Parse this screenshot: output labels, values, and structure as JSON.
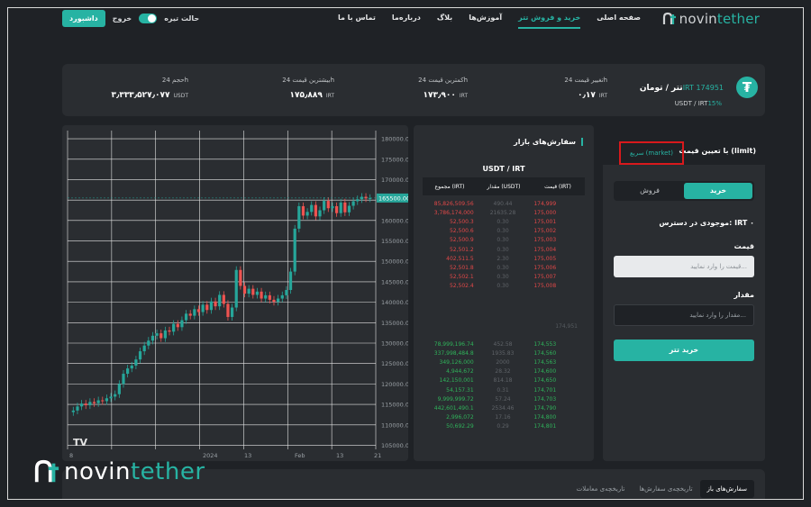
{
  "nav": {
    "logo_left": "novin",
    "logo_right": "tether",
    "menu": [
      "صفحه اصلی",
      "خرید و فروش تتر",
      "آموزش‌ها",
      "بلاگ",
      "درباره‌ما",
      "تماس با ما"
    ],
    "dashboard": "داشبورد",
    "logout": "خروج",
    "dark_mode": "حالت تیره"
  },
  "stats": {
    "coin_symbol": "₮",
    "pair_title": "تتر / تومان",
    "pair_price": "IRT 174951",
    "pair_sub": "USDT / IRT",
    "pair_change": "15%",
    "change_label": "تغییر قیمت 24h",
    "change_value": "۰٫۱۷",
    "low_label": "کمترین قیمت 24h",
    "low_value": "۱۷۳٫۹۰۰",
    "high_label": "بیشترین قیمت 24h",
    "high_value": "۱۷۵٫۸۸۹",
    "vol_label": "حجم 24h",
    "vol_value": "۳٫۳۳۳٫۵۲۷٫۰۷۷",
    "unit_irt": "IRT",
    "unit_usdt": "USDT"
  },
  "chart_data": {
    "type": "candlestick",
    "x_tick_labels": [
      "8",
      "2024",
      "13",
      "Feb",
      "13",
      "21"
    ],
    "y_ticks": [
      180000,
      175000,
      170000,
      165000,
      160000,
      155000,
      150000,
      145000,
      140000,
      135000,
      130000,
      125000,
      120000,
      115000,
      110000,
      105000
    ],
    "y_tick_labels": [
      "180000.00",
      "175000.00",
      "170000.00",
      "165000.00",
      "160000.00",
      "155000.00",
      "150000.00",
      "145000.00",
      "140000.00",
      "135000.00",
      "130000.00",
      "125000.00",
      "120000.00",
      "115000.00",
      "110000.00",
      "105000.00"
    ],
    "ylim": [
      104000,
      182000
    ],
    "last_price": 165500,
    "last_price_label": "165500.00",
    "closes": [
      113500,
      114500,
      115200,
      114800,
      115600,
      115300,
      116000,
      115800,
      116500,
      116900,
      117500,
      120000,
      122500,
      123800,
      124500,
      126000,
      128000,
      129400,
      130600,
      131800,
      132400,
      131200,
      133100,
      132800,
      134700,
      133900,
      135600,
      137200,
      136700,
      138300,
      137600,
      139400,
      138100,
      140200,
      139000,
      141800,
      139600,
      136400,
      138700,
      147900,
      144000,
      142100,
      143300,
      141800,
      142600,
      140900,
      141700,
      140600,
      140100,
      140900,
      141700,
      143000,
      147500,
      158000,
      163500,
      161200,
      162100,
      163800,
      161000,
      162500,
      164800,
      163000,
      163500,
      161800,
      164400,
      162000,
      163600,
      164700,
      165200,
      165800,
      165400,
      165500
    ]
  },
  "book": {
    "title": "سفارش‌های بازار",
    "pair": "USDT / IRT",
    "h_price": "قیمت (IRT)",
    "h_amount": "مقدار (USDT)",
    "h_total": "مجموع (IRT)",
    "sell_rows": [
      {
        "total": "85,826,509.56",
        "amount": "490.44",
        "price": "174,999"
      },
      {
        "total": "3,786,174,000",
        "amount": "21635.28",
        "price": "175,000"
      },
      {
        "total": "52,500.3",
        "amount": "0.30",
        "price": "175,001"
      },
      {
        "total": "52,500.6",
        "amount": "0.30",
        "price": "175,002"
      },
      {
        "total": "52,500.9",
        "amount": "0.30",
        "price": "175,003"
      },
      {
        "total": "52,501.2",
        "amount": "0.30",
        "price": "175,004"
      },
      {
        "total": "402,511.5",
        "amount": "2.30",
        "price": "175,005"
      },
      {
        "total": "52,501.8",
        "amount": "0.30",
        "price": "175,006"
      },
      {
        "total": "52,502.1",
        "amount": "0.30",
        "price": "175,007"
      },
      {
        "total": "52,502.4",
        "amount": "0.30",
        "price": "175,008"
      }
    ],
    "mid_price": "174,951",
    "buy_rows": [
      {
        "total": "78,999,196.74",
        "amount": "452.58",
        "price": "174,553"
      },
      {
        "total": "337,998,484.8",
        "amount": "1935.83",
        "price": "174,560"
      },
      {
        "total": "349,126,000",
        "amount": "2000",
        "price": "174,563"
      },
      {
        "total": "4,944,672",
        "amount": "28.32",
        "price": "174,600"
      },
      {
        "total": "142,150,001",
        "amount": "814.18",
        "price": "174,650"
      },
      {
        "total": "54,157.31",
        "amount": "0.31",
        "price": "174,701"
      },
      {
        "total": "9,999,999.72",
        "amount": "57.24",
        "price": "174,703"
      },
      {
        "total": "442,601,490.1",
        "amount": "2534.46",
        "price": "174,790"
      },
      {
        "total": "2,996,072",
        "amount": "17.16",
        "price": "174,800"
      },
      {
        "total": "50,692.29",
        "amount": "0.29",
        "price": "174,801"
      }
    ]
  },
  "trade": {
    "tab_limit": "با تعیین قیمت (limit)",
    "tab_market": "سریع (market)",
    "buy_tab": "خرید",
    "sell_tab": "فروش",
    "balance": "موجودی در دسترس: IRT ۰",
    "price_label": "قیمت",
    "price_placeholder": "قیمت را وارد نمایید...",
    "amount_label": "مقدار",
    "amount_placeholder": "مقدار را وارد نمایید...",
    "buy_button": "خرید تتر"
  },
  "bottom": {
    "tabs": [
      "سفارش‌های باز",
      "تاریخچه‌ی سفارش‌ها",
      "تاریخچه‌ی معاملات"
    ]
  },
  "colors": {
    "accent": "#27b3a3",
    "up": "#26a69a",
    "down": "#ef5350",
    "sell": "#e04848",
    "buy": "#2fb35a",
    "highlight_border": "#d8191c"
  },
  "icons": {
    "logo": "novintether-logo-icon",
    "coin": "tether-coin-icon",
    "tv": "tradingview-logo-icon"
  }
}
